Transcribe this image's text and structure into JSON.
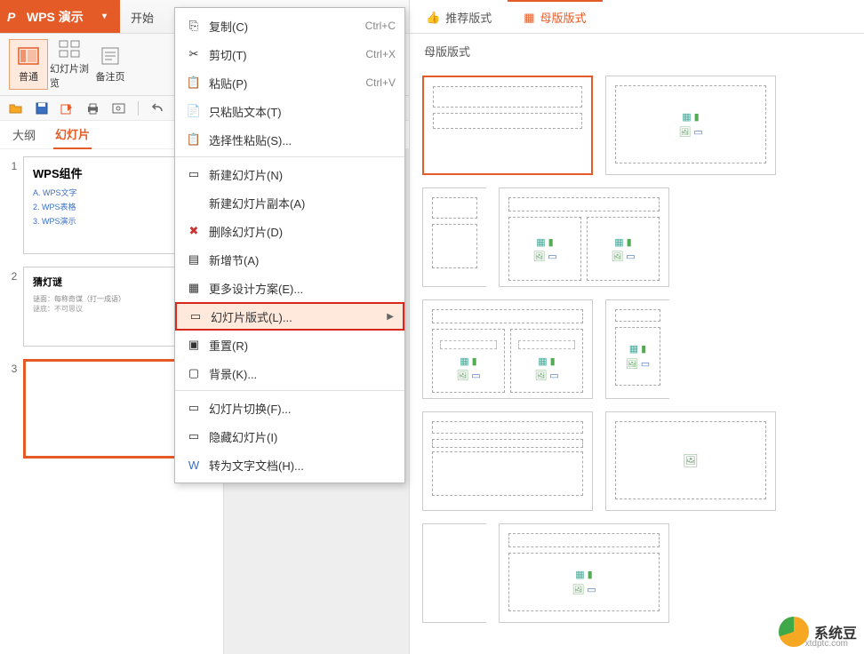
{
  "app": {
    "name": "WPS 演示"
  },
  "menu": {
    "start": "开始"
  },
  "toolbar": {
    "normal": "普通",
    "browse": "幻灯片浏览",
    "notes": "备注页"
  },
  "tabs": {
    "outline": "大纲",
    "slides": "幻灯片"
  },
  "slides": [
    {
      "num": "1",
      "title": "WPS组件",
      "items": [
        "A. WPS文字",
        "2. WPS表格",
        "3. WPS演示"
      ]
    },
    {
      "num": "2",
      "title": "猜灯谜",
      "line1": "谜面：每称奇谋（打一成语）",
      "line2": "谜底：不可思议"
    },
    {
      "num": "3",
      "title": ""
    }
  ],
  "context_menu": {
    "copy": "复制(C)",
    "copy_sc": "Ctrl+C",
    "cut": "剪切(T)",
    "cut_sc": "Ctrl+X",
    "paste": "粘贴(P)",
    "paste_sc": "Ctrl+V",
    "paste_text": "只粘贴文本(T)",
    "paste_special": "选择性粘贴(S)...",
    "new_slide": "新建幻灯片(N)",
    "dup_slide": "新建幻灯片副本(A)",
    "delete_slide": "删除幻灯片(D)",
    "new_section": "新增节(A)",
    "more_design": "更多设计方案(E)...",
    "layout": "幻灯片版式(L)...",
    "reset": "重置(R)",
    "background": "背景(K)...",
    "transition": "幻灯片切换(F)...",
    "hide": "隐藏幻灯片(I)",
    "convert": "转为文字文档(H)..."
  },
  "right_panel": {
    "tab_recommend": "推荐版式",
    "tab_master": "母版版式",
    "header": "母版版式"
  },
  "watermark": {
    "name": "系统豆",
    "url": "xtdptc.com"
  }
}
